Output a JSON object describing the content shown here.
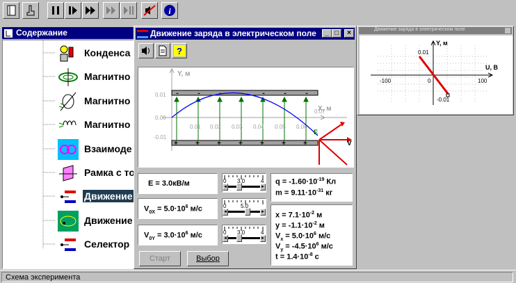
{
  "toolbar": {
    "buttons": [
      {
        "name": "book-icon"
      },
      {
        "name": "hand-pointer-icon"
      },
      {
        "name": "pause-icon"
      },
      {
        "name": "play-icon"
      },
      {
        "name": "fast-forward-icon"
      },
      {
        "name": "step-forward-icon"
      },
      {
        "name": "step-end-icon"
      },
      {
        "name": "sound-off-icon"
      },
      {
        "name": "info-icon"
      }
    ]
  },
  "toc": {
    "title": "Содержание",
    "items": [
      {
        "label": "Конденса",
        "icon": "capacitor-icon"
      },
      {
        "label": "Магнитно",
        "icon": "magnetic-field-icon"
      },
      {
        "label": "Магнитно",
        "icon": "magnetic-needle-icon"
      },
      {
        "label": "Магнитно",
        "icon": "coil-icon"
      },
      {
        "label": "Взаимоде",
        "icon": "interaction-icon"
      },
      {
        "label": "Рамка с то",
        "icon": "current-frame-icon"
      },
      {
        "label": "Движение",
        "icon": "charge-motion-icon",
        "selected": true
      },
      {
        "label": "Движение",
        "icon": "magnetic-motion-icon"
      },
      {
        "label": "Селектор",
        "icon": "selector-icon"
      }
    ]
  },
  "main_window": {
    "title": "Движение заряда в электрическом поле",
    "chart": {
      "y_label": "Y, м",
      "x_label": "X, м",
      "y_ticks": [
        "0.01",
        "0.00",
        "-0.01"
      ],
      "x_ticks": [
        "0.01",
        "0.02",
        "0.03",
        "0.04",
        "0.05",
        "0.06",
        "0.07"
      ],
      "point_label": "E",
      "vector_label": "V"
    },
    "field": {
      "prefix": "E = ",
      "value": "3.0",
      "unit": "кВ/м"
    },
    "v0x": {
      "prefix": "V",
      "sub": "0X",
      "eq": " = 5.0·10",
      "exp": "6",
      "unit": " м/с"
    },
    "v0y": {
      "prefix": "V",
      "sub": "0Y",
      "eq": " = 3.0·10",
      "exp": "6",
      "unit": " м/с"
    },
    "slider_e": {
      "min": "0",
      "mid": "3.0",
      "max": "4"
    },
    "slider_vx": {
      "min": "0",
      "mid": "5.0",
      "max": ""
    },
    "slider_vy": {
      "min": "0",
      "mid": "3.0",
      "max": "4"
    },
    "charge": {
      "q_prefix": "q = -1.60·10",
      "q_exp": "-19",
      "q_unit": " Кл",
      "m_prefix": "m = 9.11·10",
      "m_exp": "-31",
      "m_unit": " кг"
    },
    "results": {
      "x": {
        "prefix": "x = 7.1·10",
        "exp": "-2",
        "unit": " м"
      },
      "y": {
        "prefix": "y = -1.1·10",
        "exp": "-2",
        "unit": " м"
      },
      "vx": {
        "prefix": "V",
        "sub": "x",
        "eq": " = 5.0·10",
        "exp": "6",
        "unit": " м/с"
      },
      "vy": {
        "prefix": "V",
        "sub": "y",
        "eq": " = -4.5·10",
        "exp": "6",
        "unit": " м/с"
      },
      "t": {
        "prefix": "t = 1.4·10",
        "exp": "-8",
        "unit": " с"
      }
    },
    "buttons": {
      "start": "Старт",
      "select": "Выбор"
    }
  },
  "side_window": {
    "title": "Движение заряда в электрическом поле",
    "y_label": "Y, м",
    "x_label": "U, B",
    "x_ticks": [
      "-100",
      "0",
      "100"
    ],
    "y_ticks": [
      "0.01",
      "-0.01"
    ]
  },
  "status": {
    "text": "Схема эксперимента"
  }
}
